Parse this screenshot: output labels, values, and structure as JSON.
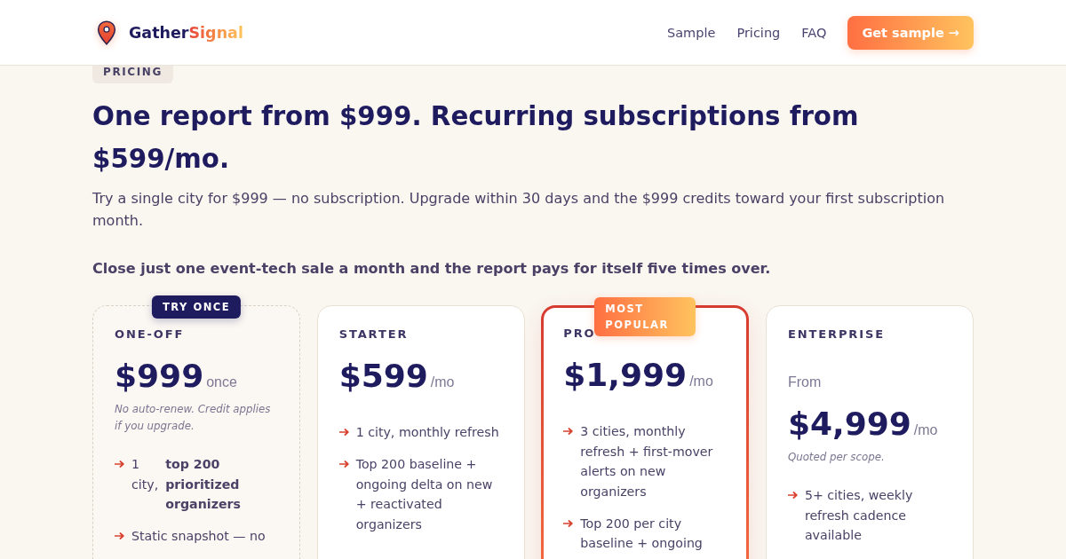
{
  "header": {
    "logo": {
      "name": "Gather",
      "accent": "Signal"
    },
    "nav": [
      {
        "label": "Sample"
      },
      {
        "label": "Pricing"
      },
      {
        "label": "FAQ"
      }
    ],
    "cta": {
      "label": "Get sample →"
    }
  },
  "pricing": {
    "eyebrow": "PRICING",
    "title": "One report from $999. Recurring subscriptions from $599/mo.",
    "subtitle": "Try a single city for $999 — no subscription. Upgrade within 30 days and the $999 credits toward your first subscription month.",
    "emphasis": "Close just one event-tech sale a month and the report pays for itself five times over.",
    "plans": [
      {
        "kind": "trial",
        "badge": {
          "kind": "dark",
          "text": "TRY ONCE"
        },
        "name": "ONE-OFF",
        "price": "$999",
        "suffix": "once",
        "note": "No auto-renew. Credit applies if you upgrade.",
        "features": [
          "1 city, **top 200 prioritized organizers**",
          "Static snapshot — no"
        ]
      },
      {
        "kind": "standard",
        "name": "STARTER",
        "price": "$599",
        "suffix": "/mo",
        "features": [
          "1 city, monthly refresh",
          "Top 200 baseline + ongoing delta on new + reactivated organizers"
        ]
      },
      {
        "kind": "featured",
        "badge": {
          "kind": "gradient",
          "text": "MOST POPULAR"
        },
        "name": "PRO",
        "price": "$1,999",
        "suffix": "/mo",
        "features": [
          "3 cities, monthly refresh + first-mover alerts on new organizers",
          "Top 200 per city baseline + ongoing"
        ]
      },
      {
        "kind": "standard",
        "name": "ENTERPRISE",
        "prefix": "From",
        "price": "$4,999",
        "suffix": "/mo",
        "note": "Quoted per scope.",
        "features": [
          "5+ cities, weekly refresh cadence available"
        ]
      }
    ]
  }
}
